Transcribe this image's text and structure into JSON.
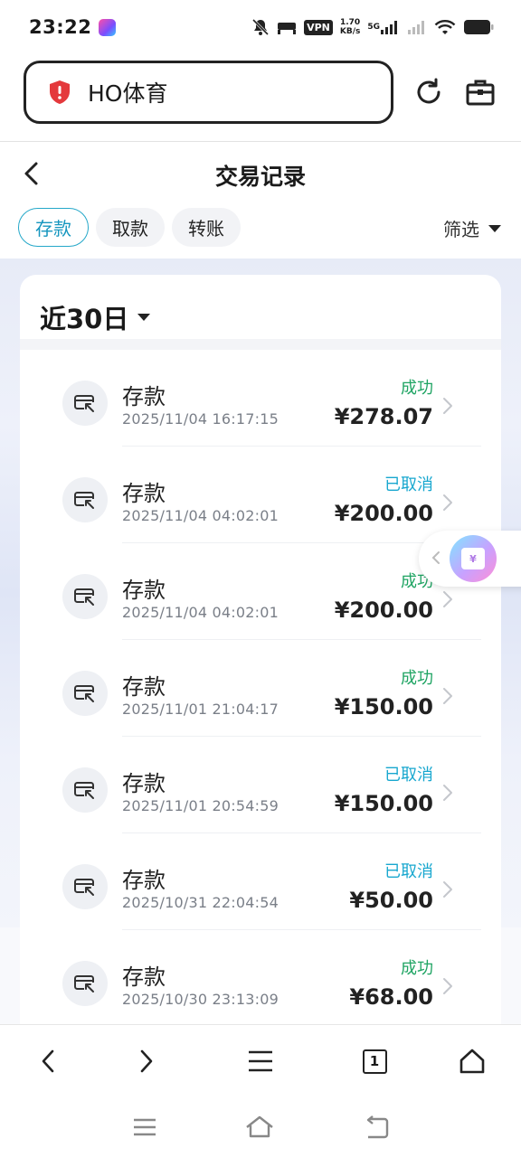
{
  "status_bar": {
    "time": "23:22",
    "vpn_label": "VPN",
    "net_speed_value": "1.70",
    "net_speed_unit": "KB/s",
    "network_type": "5G"
  },
  "browser": {
    "url_text": "HO体育",
    "tab_count": "1"
  },
  "page": {
    "title": "交易记录",
    "tabs": [
      {
        "label": "存款",
        "active": true
      },
      {
        "label": "取款",
        "active": false
      },
      {
        "label": "转账",
        "active": false
      }
    ],
    "filter_label": "筛选",
    "period_label": "近30日"
  },
  "transactions": [
    {
      "type": "存款",
      "time": "2025/11/04 16:17:15",
      "status": "成功",
      "amount": "¥278.07"
    },
    {
      "type": "存款",
      "time": "2025/11/04 04:02:01",
      "status": "已取消",
      "amount": "¥200.00"
    },
    {
      "type": "存款",
      "time": "2025/11/04 04:02:01",
      "status": "成功",
      "amount": "¥200.00"
    },
    {
      "type": "存款",
      "time": "2025/11/01 21:04:17",
      "status": "成功",
      "amount": "¥150.00"
    },
    {
      "type": "存款",
      "time": "2025/11/01 20:54:59",
      "status": "已取消",
      "amount": "¥150.00"
    },
    {
      "type": "存款",
      "time": "2025/10/31 22:04:54",
      "status": "已取消",
      "amount": "¥50.00"
    },
    {
      "type": "存款",
      "time": "2025/10/30 23:13:09",
      "status": "成功",
      "amount": "¥68.00"
    }
  ],
  "float_widget": {
    "glyph": "¥"
  },
  "colors": {
    "accent": "#1696bf",
    "success": "#1fa463",
    "cancelled": "#18a7cf"
  }
}
